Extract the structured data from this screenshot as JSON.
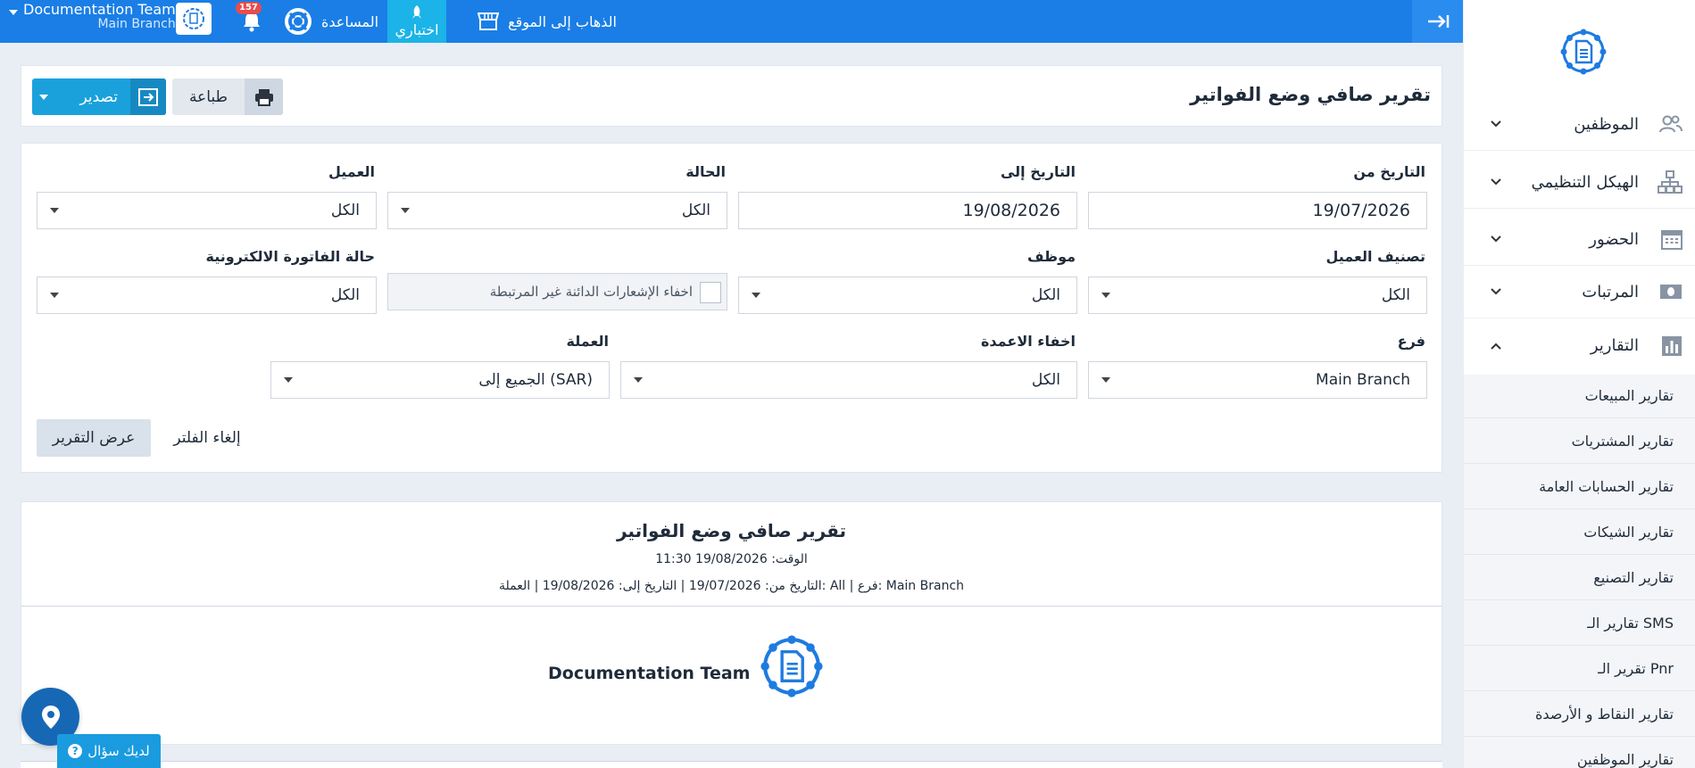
{
  "topbar": {
    "go_to_site": "الذهاب إلى الموقع",
    "my_test": "اختباري",
    "help": "المساعدة",
    "notifications_count": "157",
    "account_name": "Documentation Team",
    "account_branch": "Main Branch"
  },
  "sidebar": {
    "items": [
      {
        "label": "الموظفين",
        "icon": "users-icon"
      },
      {
        "label": "الهيكل التنظيمي",
        "icon": "org-chart-icon"
      },
      {
        "label": "الحضور",
        "icon": "calendar-icon"
      },
      {
        "label": "المرتبات",
        "icon": "money-icon"
      },
      {
        "label": "التقارير",
        "icon": "bar-chart-icon"
      }
    ],
    "subitems": [
      "تقارير المبيعات",
      "تقارير المشتريات",
      "تقارير الحسابات العامة",
      "تقارير الشيكات",
      "تقارير التصنيع",
      "تقارير الـ SMS",
      "تقرير الـ Pnr",
      "تقارير النقاط و الأرصدة",
      "تقارير الموظفين"
    ]
  },
  "page": {
    "title": "تقرير صافي وضع الفواتير",
    "print_label": "طباعة",
    "export_label": "تصدير"
  },
  "filters": {
    "date_from_label": "التاريخ من",
    "date_from_value": "19/07/2026",
    "date_to_label": "التاريخ إلى",
    "date_to_value": "19/08/2026",
    "status_label": "الحالة",
    "status_value": "الكل",
    "client_label": "العميل",
    "client_value": "الكل",
    "client_category_label": "تصنيف العميل",
    "client_category_value": "الكل",
    "employee_label": "موظف",
    "employee_value": "الكل",
    "hide_unlinked_label": "اخفاء الإشعارات الدائنة غير المرتبطة",
    "einvoice_status_label": "حالة الفاتورة الالكترونية",
    "einvoice_status_value": "الكل",
    "branch_label": "فرع",
    "branch_value": "Main Branch",
    "hide_columns_label": "اخفاء الاعمدة",
    "hide_columns_value": "الكل",
    "currency_label": "العملة",
    "currency_value": "الجميع إلى (SAR)",
    "show_report_label": "عرض التقرير",
    "cancel_filter_label": "إلغاء الفلتر"
  },
  "report": {
    "title": "تقرير صافي وضع الفواتير",
    "time_line": "الوقت: 19/08/2026 11:30",
    "meta_line": "التاريخ من: 19/07/2026 | التاريخ إلى: 19/08/2026 | العملة: All | فرع: Main Branch",
    "company_name": "Documentation Team"
  },
  "floating": {
    "question_label": "لديك سؤال"
  },
  "colors": {
    "topbar": "#1a7ee6",
    "accent": "#1aa1dc",
    "logo_blue": "#1f7be0"
  }
}
